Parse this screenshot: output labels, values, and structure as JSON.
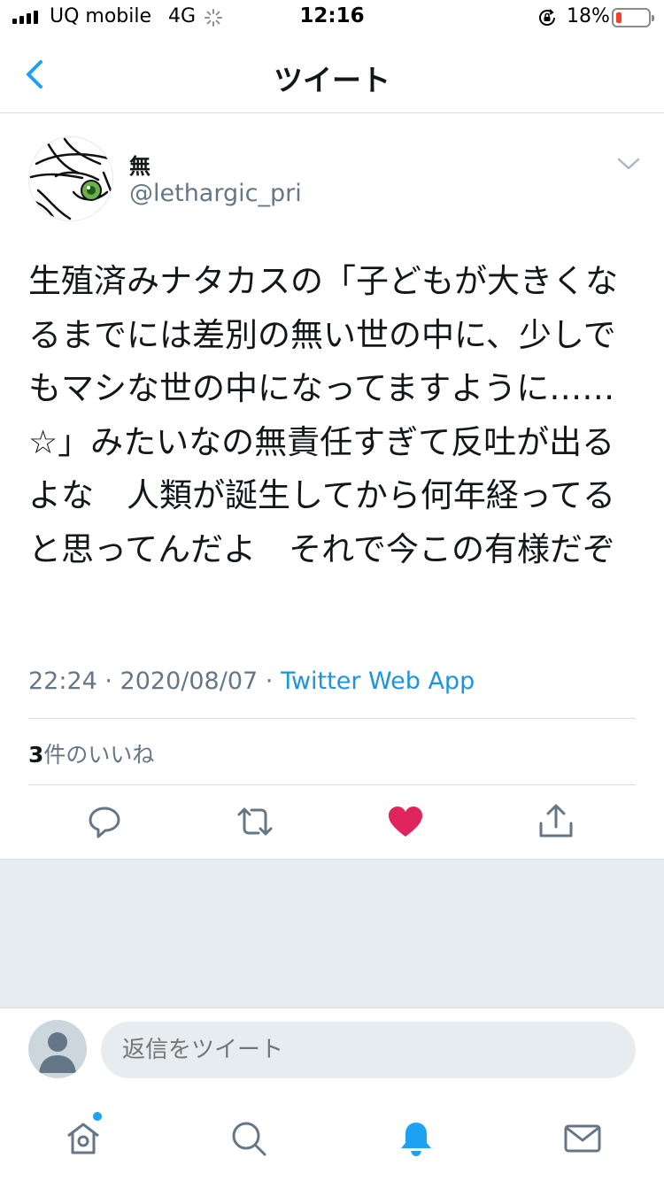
{
  "status_bar": {
    "carrier": "UQ mobile",
    "network": "4G",
    "time": "12:16",
    "battery_percent": "18%",
    "battery_level": 0.18,
    "battery_color": "#ff3b30"
  },
  "nav": {
    "title": "ツイート",
    "back_icon": "chevron-left-icon"
  },
  "tweet": {
    "display_name": "無",
    "handle": "@lethargic_pri",
    "text": "生殖済みナタカスの「子どもが大きくなるまでには差別の無い世の中に、少しでもマシな世の中になってますように……☆」みたいなの無責任すぎて反吐が出るよな　人類が誕生してから何年経ってると思ってんだよ　それで今この有様だぞ",
    "timestamp": "22:24 · 2020/08/07 · ",
    "source": "Twitter Web App",
    "like_count": "3",
    "like_label": "件のいいね",
    "liked": true
  },
  "actions": {
    "reply": "reply-icon",
    "retweet": "retweet-icon",
    "like": "heart-icon",
    "share": "share-icon"
  },
  "reply": {
    "placeholder": "返信をツイート"
  },
  "tabbar": {
    "items": [
      "home-icon",
      "search-icon",
      "notifications-icon",
      "messages-icon"
    ],
    "active": "notifications-icon"
  },
  "colors": {
    "accent": "#1da1f2",
    "link": "#1b95e0",
    "like": "#e0245e",
    "secondary_text": "#657786"
  }
}
